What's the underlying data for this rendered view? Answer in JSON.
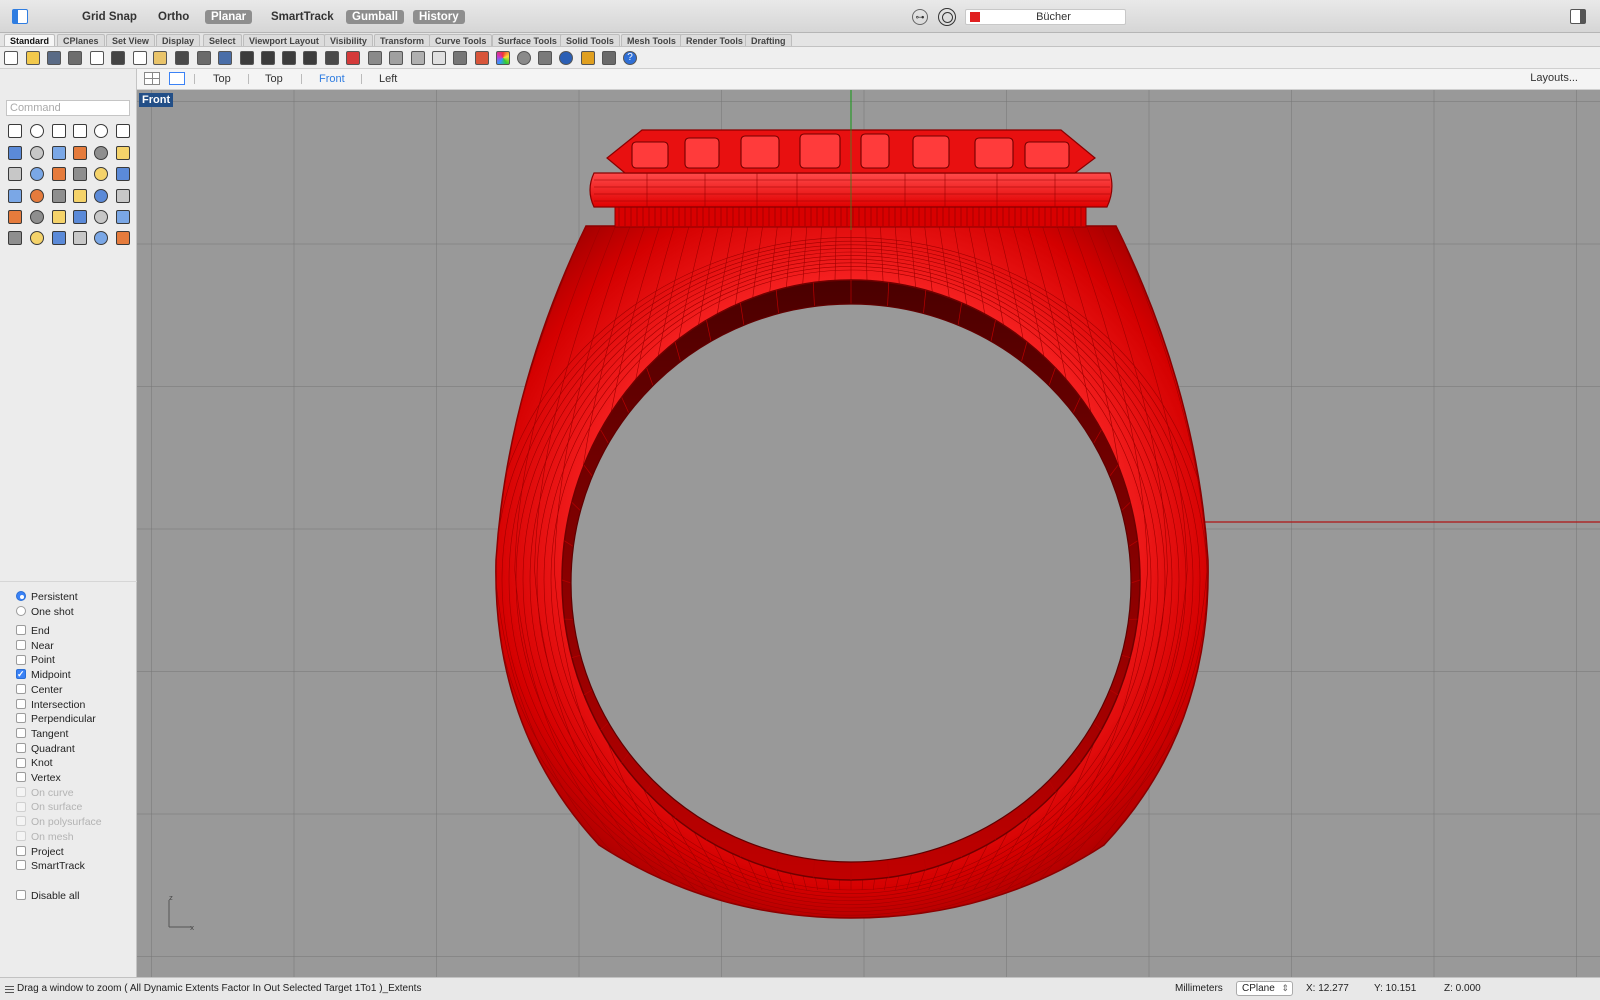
{
  "topbar": {
    "modes": [
      {
        "label": "Grid Snap",
        "on": false
      },
      {
        "label": "Ortho",
        "on": false
      },
      {
        "label": "Planar",
        "on": true
      },
      {
        "label": "SmartTrack",
        "on": false
      },
      {
        "label": "Gumball",
        "on": true
      },
      {
        "label": "History",
        "on": true
      }
    ],
    "layer": {
      "name": "Bücher",
      "color": "#e02020"
    }
  },
  "tabs": [
    "Standard",
    "CPlanes",
    "Set View",
    "Display",
    "Select",
    "Viewport Layout",
    "Visibility",
    "Transform",
    "Curve Tools",
    "Surface Tools",
    "Solid Tools",
    "Mesh Tools",
    "Render Tools",
    "Drafting"
  ],
  "toolbar_icons": [
    "new-icon",
    "open-icon",
    "save-icon",
    "print-icon",
    "import-icon",
    "cut-icon",
    "copy-icon",
    "paste-icon",
    "undo-icon",
    "pan-icon",
    "rotate-view-icon",
    "zoom-icon",
    "zoom-window-icon",
    "zoom-extents-icon",
    "zoom-selected-icon",
    "rotate-icon",
    "car-icon",
    "hidden-icon",
    "hide-icon",
    "show-icon",
    "lightbulb-icon",
    "lock-icon",
    "layer-icon",
    "rendered-icon",
    "material-icon",
    "mesh-icon",
    "render-icon",
    "pointer-filter-icon",
    "grid-icon",
    "help-icon"
  ],
  "command": {
    "placeholder": "Command",
    "value": ""
  },
  "tool_icons": [
    "select-icon",
    "point-icon",
    "polyline-icon",
    "rectangle-icon",
    "circle-icon",
    "ellipse-icon",
    "curve-icon",
    "box-icon",
    "polygon-icon",
    "fillet-icon",
    "surface-icon",
    "sweep-icon",
    "solid-icon",
    "boolean-icon",
    "cylinder-icon",
    "extrude-icon",
    "patch-icon",
    "explode-icon",
    "trim-icon",
    "split-icon",
    "join-icon",
    "group-icon",
    "arc-icon",
    "offset-icon",
    "move-icon",
    "scale-icon",
    "array-icon",
    "mirror-icon",
    "cage-icon",
    "dimension-icon",
    "grid-array-icon",
    "align-icon",
    "analyze-icon",
    "check-icon",
    "render-preview-icon",
    "sun-icon"
  ],
  "osnap": {
    "modes": [
      {
        "label": "Persistent",
        "checked": true
      },
      {
        "label": "One shot",
        "checked": false
      }
    ],
    "snaps": [
      {
        "label": "End",
        "checked": false,
        "disabled": false
      },
      {
        "label": "Near",
        "checked": false,
        "disabled": false
      },
      {
        "label": "Point",
        "checked": false,
        "disabled": false
      },
      {
        "label": "Midpoint",
        "checked": true,
        "disabled": false
      },
      {
        "label": "Center",
        "checked": false,
        "disabled": false
      },
      {
        "label": "Intersection",
        "checked": false,
        "disabled": false
      },
      {
        "label": "Perpendicular",
        "checked": false,
        "disabled": false
      },
      {
        "label": "Tangent",
        "checked": false,
        "disabled": false
      },
      {
        "label": "Quadrant",
        "checked": false,
        "disabled": false
      },
      {
        "label": "Knot",
        "checked": false,
        "disabled": false
      },
      {
        "label": "Vertex",
        "checked": false,
        "disabled": false
      },
      {
        "label": "On curve",
        "checked": false,
        "disabled": true
      },
      {
        "label": "On surface",
        "checked": false,
        "disabled": true
      },
      {
        "label": "On polysurface",
        "checked": false,
        "disabled": true
      },
      {
        "label": "On mesh",
        "checked": false,
        "disabled": true
      },
      {
        "label": "Project",
        "checked": false,
        "disabled": false
      },
      {
        "label": "SmartTrack",
        "checked": false,
        "disabled": false
      }
    ],
    "disable_all": {
      "label": "Disable all",
      "checked": false
    }
  },
  "viewport_tabs": [
    {
      "label": "Top",
      "active": false
    },
    {
      "label": "Top",
      "active": false
    },
    {
      "label": "Front",
      "active": true
    },
    {
      "label": "Left",
      "active": false
    }
  ],
  "layouts_label": "Layouts...",
  "viewport": {
    "label": "Front",
    "object_color": "#e00000",
    "axis_labels": {
      "z": "z",
      "x": "x"
    }
  },
  "status": {
    "message": "Drag a window to zoom ( All Dynamic Extents Factor In Out Selected Target 1To1 )_Extents",
    "units": "Millimeters",
    "cplane": "CPlane",
    "x": "X: 12.277",
    "y": "Y: 10.151",
    "z": "Z: 0.000"
  }
}
